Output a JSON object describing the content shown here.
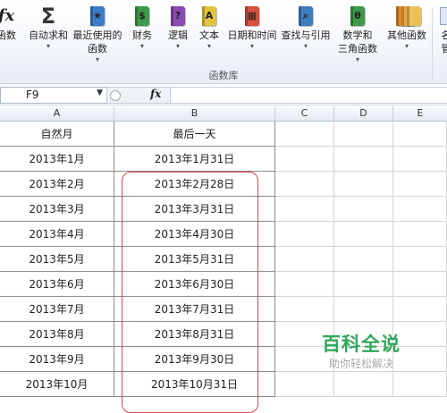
{
  "ribbon": {
    "group_label": "函数库",
    "buttons": [
      {
        "name": "insert-function-button",
        "label": "函数",
        "icon": "fx-icon",
        "dropdown": false
      },
      {
        "name": "autosum-button",
        "label": "自动求和",
        "icon": "sigma-icon",
        "dropdown": true
      },
      {
        "name": "recently-used-button",
        "label": "最近使用的",
        "label2": "函数",
        "icon": "star-book-icon",
        "dropdown": true
      },
      {
        "name": "financial-button",
        "label": "财务",
        "icon": "financial-book-icon",
        "dropdown": true
      },
      {
        "name": "logical-button",
        "label": "逻辑",
        "icon": "question-book-icon",
        "dropdown": true
      },
      {
        "name": "text-button",
        "label": "文本",
        "icon": "text-book-icon",
        "dropdown": true
      },
      {
        "name": "datetime-button",
        "label": "日期和时间",
        "icon": "calendar-book-icon",
        "dropdown": true
      },
      {
        "name": "lookup-button",
        "label": "查找与引用",
        "icon": "lookup-book-icon",
        "dropdown": true
      },
      {
        "name": "math-trig-button",
        "label": "数学和",
        "label2": "三角函数",
        "icon": "theta-book-icon",
        "dropdown": true
      },
      {
        "name": "more-functions-button",
        "label": "其他函数",
        "icon": "books-icon",
        "dropdown": true
      },
      {
        "name": "name-manager-button",
        "label": "名",
        "label2": "管",
        "icon": "name-manager-icon",
        "dropdown": false
      }
    ]
  },
  "formula_bar": {
    "name_box": "F9",
    "fx_label": "fx",
    "formula": ""
  },
  "columns": [
    "A",
    "B",
    "C",
    "D",
    "E"
  ],
  "header_row": {
    "a": "自然月",
    "b": "最后一天"
  },
  "rows": [
    {
      "a": "2013年1月",
      "b": "2013年1月31日"
    },
    {
      "a": "2013年2月",
      "b": "2013年2月28日"
    },
    {
      "a": "2013年3月",
      "b": "2013年3月31日"
    },
    {
      "a": "2013年4月",
      "b": "2013年4月30日"
    },
    {
      "a": "2013年5月",
      "b": "2013年5月31日"
    },
    {
      "a": "2013年6月",
      "b": "2013年6月30日"
    },
    {
      "a": "2013年7月",
      "b": "2013年7月31日"
    },
    {
      "a": "2013年8月",
      "b": "2013年8月31日"
    },
    {
      "a": "2013年9月",
      "b": "2013年9月30日"
    },
    {
      "a": "2013年10月",
      "b": "2013年10月31日"
    }
  ],
  "watermark": {
    "title": "百科全说",
    "subtitle": "助你轻松解决"
  },
  "colors": {
    "highlight": "#d9484f",
    "watermark": "#2fa85a"
  }
}
